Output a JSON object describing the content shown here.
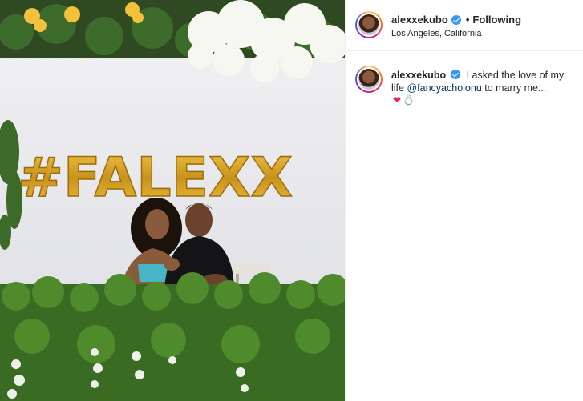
{
  "post": {
    "balloon_text": "#FALEXX"
  },
  "header": {
    "username": "alexxekubo",
    "separator": "•",
    "follow_status": "Following",
    "location": "Los Angeles, California"
  },
  "caption": {
    "username": "alexxekubo",
    "text_before_mention": "I asked the love of my life",
    "mention": "@fancyacholonu",
    "text_after_mention": "to marry me...",
    "emoji_1": "❤",
    "emoji_2": "💍"
  },
  "icons": {
    "verified": "verified-badge-icon",
    "avatar": "profile-avatar"
  },
  "colors": {
    "balloon_gold": "#d9a520",
    "verified_blue": "#3897f0",
    "mention_blue": "#00376b"
  }
}
